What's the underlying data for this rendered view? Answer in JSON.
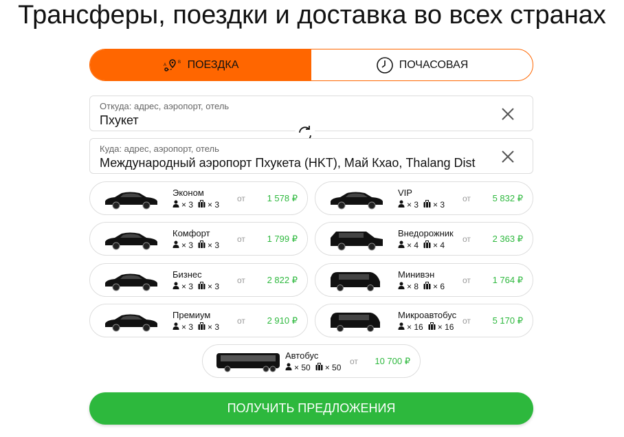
{
  "header": {
    "title": "Трансферы, поездки и доставка во всех странах"
  },
  "tabs": [
    {
      "label": "ПОЕЗДКА",
      "icon": "route-icon",
      "active": true
    },
    {
      "label": "ПОЧАСОВАЯ",
      "icon": "clock-icon",
      "active": false
    }
  ],
  "from": {
    "label": "Откуда: адрес, аэропорт, отель",
    "value": "Пхукет"
  },
  "to": {
    "label": "Куда: адрес, аэропорт, отель",
    "value": "Международный аэропорт Пхукета (HKT), Май Кхао, Thalang Dist"
  },
  "from_label": "от",
  "cars": [
    {
      "name": "Эконом",
      "pax": "× 3",
      "bags": "× 3",
      "price": "1 578 ₽"
    },
    {
      "name": "VIP",
      "pax": "× 3",
      "bags": "× 3",
      "price": "5 832 ₽"
    },
    {
      "name": "Комфорт",
      "pax": "× 3",
      "bags": "× 3",
      "price": "1 799 ₽"
    },
    {
      "name": "Внедорожник",
      "pax": "× 4",
      "bags": "× 4",
      "price": "2 363 ₽"
    },
    {
      "name": "Бизнес",
      "pax": "× 3",
      "bags": "× 3",
      "price": "2 822 ₽"
    },
    {
      "name": "Минивэн",
      "pax": "× 8",
      "bags": "× 6",
      "price": "1 764 ₽"
    },
    {
      "name": "Премиум",
      "pax": "× 3",
      "bags": "× 3",
      "price": "2 910 ₽"
    },
    {
      "name": "Микроавтобус",
      "pax": "× 16",
      "bags": "× 16",
      "price": "5 170 ₽"
    },
    {
      "name": "Автобус",
      "pax": "× 50",
      "bags": "× 50",
      "price": "10 700 ₽"
    }
  ],
  "submit": {
    "label": "ПОЛУЧИТЬ ПРЕДЛОЖЕНИЯ"
  },
  "colors": {
    "accent": "#ff6600",
    "price": "#2db83d",
    "button": "#2db83d"
  }
}
